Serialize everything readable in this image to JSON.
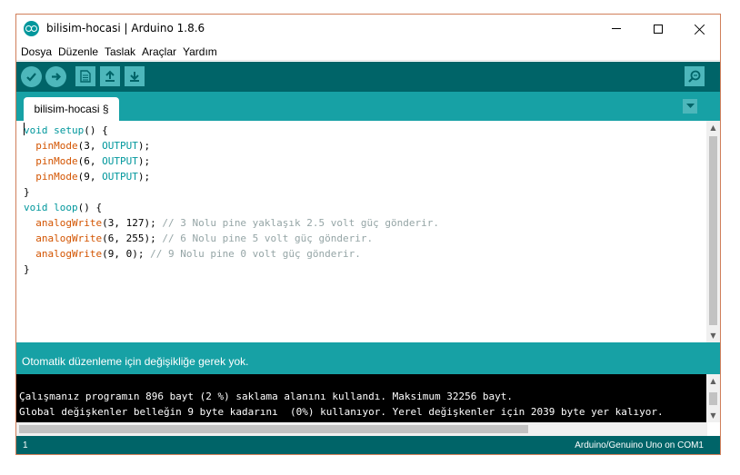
{
  "window": {
    "title": "bilisim-hocasi | Arduino 1.8.6"
  },
  "menu": [
    "Dosya",
    "Düzenle",
    "Taslak",
    "Araçlar",
    "Yardım"
  ],
  "toolbar": {
    "buttons": [
      "verify-icon",
      "upload-icon",
      "new-icon",
      "open-icon",
      "save-icon"
    ],
    "serial_monitor": "serial-monitor-icon"
  },
  "tabs": {
    "active": "bilisim-hocasi §"
  },
  "editor": {
    "lines": [
      [
        {
          "t": "void",
          "c": "kw"
        },
        {
          "t": " "
        },
        {
          "t": "setup",
          "c": "kw"
        },
        {
          "t": "() {"
        }
      ],
      [
        {
          "t": "  "
        },
        {
          "t": "pinMode",
          "c": "fn"
        },
        {
          "t": "(3, "
        },
        {
          "t": "OUTPUT",
          "c": "cst"
        },
        {
          "t": ");"
        }
      ],
      [
        {
          "t": "  "
        },
        {
          "t": "pinMode",
          "c": "fn"
        },
        {
          "t": "(6, "
        },
        {
          "t": "OUTPUT",
          "c": "cst"
        },
        {
          "t": ");"
        }
      ],
      [
        {
          "t": "  "
        },
        {
          "t": "pinMode",
          "c": "fn"
        },
        {
          "t": "(9, "
        },
        {
          "t": "OUTPUT",
          "c": "cst"
        },
        {
          "t": ");"
        }
      ],
      [
        {
          "t": "}"
        }
      ],
      [
        {
          "t": "void",
          "c": "kw"
        },
        {
          "t": " "
        },
        {
          "t": "loop",
          "c": "kw"
        },
        {
          "t": "() {"
        }
      ],
      [
        {
          "t": "  "
        },
        {
          "t": "analogWrite",
          "c": "fn"
        },
        {
          "t": "(3, 127); "
        },
        {
          "t": "// 3 Nolu pine yaklaşık 2.5 volt güç gönderir.",
          "c": "cm"
        }
      ],
      [
        {
          "t": "  "
        },
        {
          "t": "analogWrite",
          "c": "fn"
        },
        {
          "t": "(6, 255); "
        },
        {
          "t": "// 6 Nolu pine 5 volt güç gönderir.",
          "c": "cm"
        }
      ],
      [
        {
          "t": "  "
        },
        {
          "t": "analogWrite",
          "c": "fn"
        },
        {
          "t": "(9, 0); "
        },
        {
          "t": "// 9 Nolu pine 0 volt güç gönderir.",
          "c": "cm"
        }
      ],
      [
        {
          "t": "}"
        }
      ]
    ]
  },
  "status": {
    "message": "Otomatik düzenleme için değişikliğe gerek yok."
  },
  "console": {
    "lines": [
      "Çalışmanız programın 896 bayt (2 %) saklama alanını kullandı. Maksimum 32256 bayt.",
      "Global değişkenler belleğin 9 byte kadarını  (0%) kullanıyor. Yerel değişkenler için 2039 byte yer kalıyor."
    ]
  },
  "footer": {
    "line_number": "1",
    "board": "Arduino/Genuino Uno on COM1"
  }
}
